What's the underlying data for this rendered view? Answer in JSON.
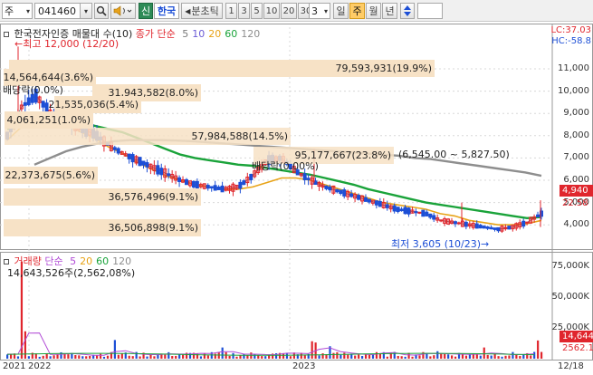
{
  "toolbar": {
    "market_select": "주",
    "code_input": "041460",
    "shin_label": "신",
    "stock_name": "한국",
    "split_label": "분초틱",
    "tick_buttons": [
      "1",
      "3",
      "5",
      "10",
      "20",
      "30"
    ],
    "count_value": "3",
    "period_buttons": [
      "일",
      "주",
      "월",
      "년"
    ],
    "active_period": "주"
  },
  "header": {
    "title": "한국전자인증 매물대 수(10)",
    "ma_prefix": "종가 단순",
    "ma_periods": [
      "5",
      "10",
      "20",
      "60",
      "120"
    ],
    "lc_label": "LC:37.03",
    "hc_label": "HC:-58.8"
  },
  "volume_profile": [
    {
      "label": "79,593,931(19.9%)"
    },
    {
      "label": "14,564,644(3.6%)"
    },
    {
      "label": "31,943,582(8.0%)"
    },
    {
      "label": "21,535,036(5.4%)"
    },
    {
      "label": "4,061,251(1.0%)"
    },
    {
      "label": "57,984,588(14.5%)"
    },
    {
      "label": "95,177,667(23.8%)"
    },
    {
      "label": "22,373,675(5.6%)"
    },
    {
      "label": "36,576,496(9.1%)"
    },
    {
      "label": "36,506,898(9.1%)"
    }
  ],
  "annotations": {
    "high": "최고 12,000 (12/20)",
    "low": "최저 3,605 (10/23)",
    "dividend1": "배당락(0.0%)",
    "dividend2": "배당락(0.00%)",
    "range": "(6,545.00 ~ 5,827.50)"
  },
  "price_axis": [
    "11,000",
    "10,000",
    "9,000",
    "8,000",
    "7,000",
    "6,000",
    "5,000",
    "4,000"
  ],
  "price_tags": {
    "current": "4,940",
    "other": "22.58"
  },
  "volume_header": {
    "title": "거래량",
    "ma_prefix": "단순",
    "ma_periods": [
      "5",
      "20",
      "60",
      "120"
    ],
    "info": "14,643,526주(2,562,08%)"
  },
  "volume_axis": [
    "75,000K",
    "50,000K",
    "25,000K"
  ],
  "volume_tags": {
    "current": "14,644",
    "ma": "2562.1"
  },
  "x_axis": {
    "labels": [
      "2021",
      "2022",
      "2023",
      "12/18"
    ]
  },
  "colors": {
    "ma5": "#7a7a7a",
    "ma10": "#6b5bd6",
    "ma20": "#e8a317",
    "ma60": "#1aa33a",
    "ma120": "#8e8e8e",
    "up": "#e0262d",
    "down": "#1d4fd6",
    "profile": "#f7e2c6",
    "volume": "#e0262d"
  },
  "icons": [
    "dropdown-icon",
    "search-icon",
    "speaker-icon",
    "scroll-arrows-icon"
  ],
  "chart_data": {
    "type": "candlestick",
    "title": "한국전자인증",
    "ylim": [
      3000,
      12000
    ],
    "series": [
      {
        "name": "5",
        "values": [
          8000,
          9300,
          9800,
          9000,
          8800,
          8300,
          8100,
          7600,
          7200,
          6900,
          6600,
          6300,
          6000,
          5800,
          5700,
          5600,
          5700,
          6200,
          6900,
          7000,
          6400,
          6000,
          5700,
          5500,
          5300,
          5100,
          4900,
          4700,
          4600,
          4500,
          4200,
          4100,
          4000,
          3900,
          3800,
          3900,
          4100,
          4500
        ]
      },
      {
        "name": "20",
        "values": [
          7800,
          8400,
          8800,
          8700,
          8500,
          8200,
          7900,
          7500,
          7200,
          6800,
          6500,
          6200,
          6000,
          5800,
          5700,
          5600,
          5600,
          5700,
          5900,
          6100,
          6100,
          6000,
          5800,
          5600,
          5400,
          5200,
          5000,
          4900,
          4800,
          4700,
          4500,
          4400,
          4200,
          4100,
          4000,
          4000,
          4050,
          4200
        ]
      },
      {
        "name": "60",
        "values": [
          8300,
          8400,
          8500,
          8550,
          8600,
          8550,
          8450,
          8300,
          8150,
          7900,
          7650,
          7400,
          7150,
          7000,
          6900,
          6800,
          6700,
          6650,
          6550,
          6450,
          6350,
          6250,
          6100,
          5950,
          5800,
          5600,
          5450,
          5300,
          5150,
          5000,
          4900,
          4800,
          4700,
          4600,
          4500,
          4400,
          4300,
          4350
        ]
      },
      {
        "name": "120",
        "values": [
          6700,
          7000,
          7300,
          7500,
          7650,
          7750,
          7800,
          7800,
          7800,
          7780,
          7750,
          7700,
          7650,
          7600,
          7550,
          7500,
          7450,
          7400,
          7350,
          7300,
          7250,
          7200,
          7150,
          7100,
          7000,
          6950,
          6850,
          6750,
          6650,
          6550,
          6450,
          6350,
          6200
        ]
      }
    ]
  }
}
